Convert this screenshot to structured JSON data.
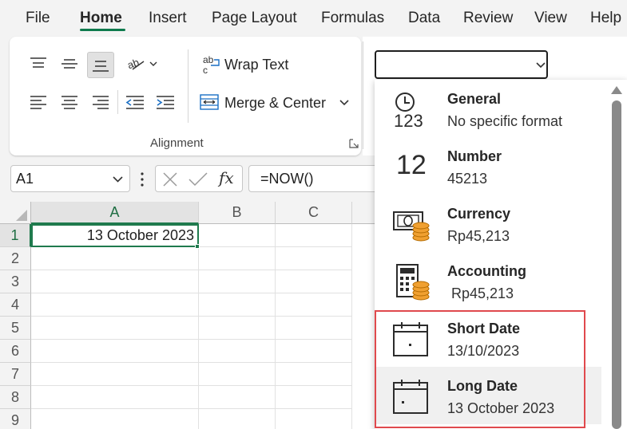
{
  "tabs": [
    {
      "label": "File",
      "active": false
    },
    {
      "label": "Home",
      "active": true
    },
    {
      "label": "Insert",
      "active": false
    },
    {
      "label": "Page Layout",
      "active": false
    },
    {
      "label": "Formulas",
      "active": false
    },
    {
      "label": "Data",
      "active": false
    },
    {
      "label": "Review",
      "active": false
    },
    {
      "label": "View",
      "active": false
    },
    {
      "label": "Help",
      "active": false
    }
  ],
  "ribbon": {
    "wrap_text": "Wrap Text",
    "merge_center": "Merge & Center",
    "group_label": "Alignment",
    "number_format_value": ""
  },
  "formula_bar": {
    "name_box": "A1",
    "formula": "=NOW()"
  },
  "sheet": {
    "columns": [
      "A",
      "B",
      "C"
    ],
    "rows": [
      "1",
      "2",
      "3",
      "4",
      "5",
      "6",
      "7",
      "8",
      "9"
    ],
    "a1_value": "13 October 2023"
  },
  "format_menu": {
    "items": [
      {
        "title": "General",
        "example": "No specific format",
        "icon": "clock-123-icon"
      },
      {
        "title": "Number",
        "example": "45213",
        "icon": "number-12-icon"
      },
      {
        "title": "Currency",
        "example": "Rp45,213",
        "icon": "banknote-coins-icon"
      },
      {
        "title": "Accounting",
        "example": " Rp45,213",
        "icon": "calculator-coins-icon"
      },
      {
        "title": "Short Date",
        "example": "13/10/2023",
        "icon": "calendar-icon"
      },
      {
        "title": "Long Date",
        "example": "13 October 2023",
        "icon": "calendar-icon"
      }
    ],
    "icon_text": {
      "general": "123",
      "number": "12"
    }
  },
  "colors": {
    "accent": "#0e7a4d",
    "highlight": "#e0494d",
    "coin": "#f0a030"
  }
}
